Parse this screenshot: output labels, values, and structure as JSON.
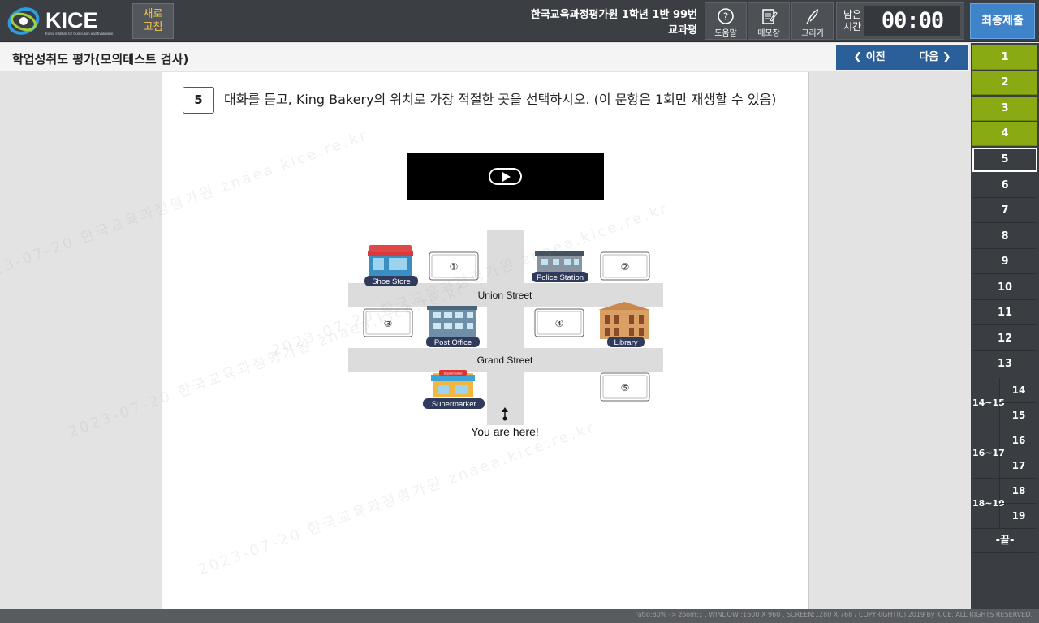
{
  "header": {
    "logo_text": "KICE",
    "logo_subtext": "Korea Institute for Curriculum and Evaluation",
    "refresh_label": [
      "새로",
      "고침"
    ],
    "student_line1": "한국교육과정평가원 1학년 1반 99번",
    "student_line2": "교과평",
    "tools": [
      {
        "label": "도움말",
        "icon": "help-icon"
      },
      {
        "label": "메모장",
        "icon": "memo-icon"
      },
      {
        "label": "그리기",
        "icon": "pen-icon"
      }
    ],
    "time_label": [
      "남은",
      "시간"
    ],
    "time_value": "00:00",
    "final_submit": "최종제출"
  },
  "subheader": {
    "title": "학업성취도 평가(모의테스트 검사)",
    "prev_label": "이전",
    "next_label": "다음"
  },
  "question": {
    "number": "5",
    "text": "대화를 듣고, King Bakery의 위치로 가장 적절한 곳을 선택하시오. (이 문항은 1회만 재생할 수 있음)"
  },
  "map": {
    "streets": [
      "Union Street",
      "Grand Street"
    ],
    "places": [
      "Shoe Store",
      "Police Station",
      "Post Office",
      "Library",
      "Supermarket"
    ],
    "options": [
      "①",
      "②",
      "③",
      "④",
      "⑤"
    ],
    "you_are_here": "You are here!",
    "supermarket_sign": "Supermarket"
  },
  "sidebar": {
    "items": [
      {
        "label": "1",
        "state": "done"
      },
      {
        "label": "2",
        "state": "done"
      },
      {
        "label": "3",
        "state": "done"
      },
      {
        "label": "4",
        "state": "done"
      },
      {
        "label": "5",
        "state": "current"
      },
      {
        "label": "6",
        "state": "todo"
      },
      {
        "label": "7",
        "state": "todo"
      },
      {
        "label": "8",
        "state": "todo"
      },
      {
        "label": "9",
        "state": "todo"
      },
      {
        "label": "10",
        "state": "todo"
      },
      {
        "label": "11",
        "state": "todo"
      },
      {
        "label": "12",
        "state": "todo"
      },
      {
        "label": "13",
        "state": "todo"
      }
    ],
    "groups": [
      {
        "label": "14~15",
        "subs": [
          "14",
          "15"
        ]
      },
      {
        "label": "16~17",
        "subs": [
          "16",
          "17"
        ]
      },
      {
        "label": "18~19",
        "subs": [
          "18",
          "19"
        ]
      }
    ],
    "end_label": "-끝-"
  },
  "watermark": "2023-07-20 한국교육과정평가원 znaea.kice.re.kr",
  "footer": "ratio:80% -> zoom:1 , WINDOW :1600 X 960 , SCREEN:1280 X 768 / COPYRIGHT(C) 2019 by KICE. ALL RIGHTS RESERVED.",
  "colors": {
    "header_bg": "#3b3f44",
    "done": "#8aaa14",
    "nav": "#2b5f99",
    "submit": "#3f83c9",
    "refresh_text": "#f6c94a"
  }
}
